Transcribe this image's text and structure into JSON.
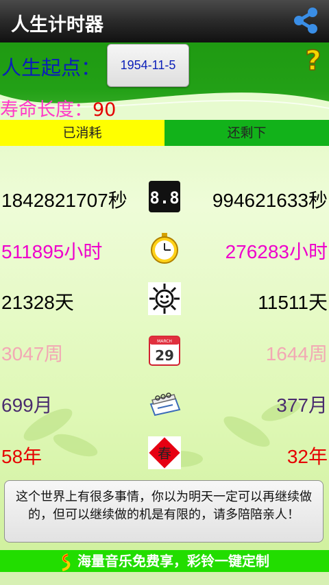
{
  "app": {
    "title": "人生计时器"
  },
  "header": {
    "start_label": "人生起点：",
    "start_date": "1954-11-5",
    "life_label": "寿命长度：",
    "life_value": "90"
  },
  "tabs": {
    "used": "已消耗",
    "left": "还剩下"
  },
  "rows": [
    {
      "used": "1842821707秒",
      "left": "994621633秒",
      "icon": "digital-clock-icon",
      "color": "#000000"
    },
    {
      "used": "511895小时",
      "left": "276283小时",
      "icon": "stopwatch-icon",
      "color": "#ee00cc"
    },
    {
      "used": "21328天",
      "left": "11511天",
      "icon": "sun-face-icon",
      "color": "#000000"
    },
    {
      "used": "3047周",
      "left": "1644周",
      "icon": "calendar-icon",
      "color": "#f2a8b4"
    },
    {
      "used": "699月",
      "left": "377月",
      "icon": "desk-calendar-icon",
      "color": "#4a2c6e"
    },
    {
      "used": "58年",
      "left": "32年",
      "icon": "chun-icon",
      "color": "#e60000"
    }
  ],
  "calendar_day": "29",
  "calendar_month": "MARCH",
  "chun_char": "春",
  "message": "这个世界上有很多事情，你以为明天一定可以再继续做的，但可以继续做的机是有限的，请多陪陪亲人！",
  "ad": {
    "text": "海量音乐免费享，彩铃一键定制"
  }
}
